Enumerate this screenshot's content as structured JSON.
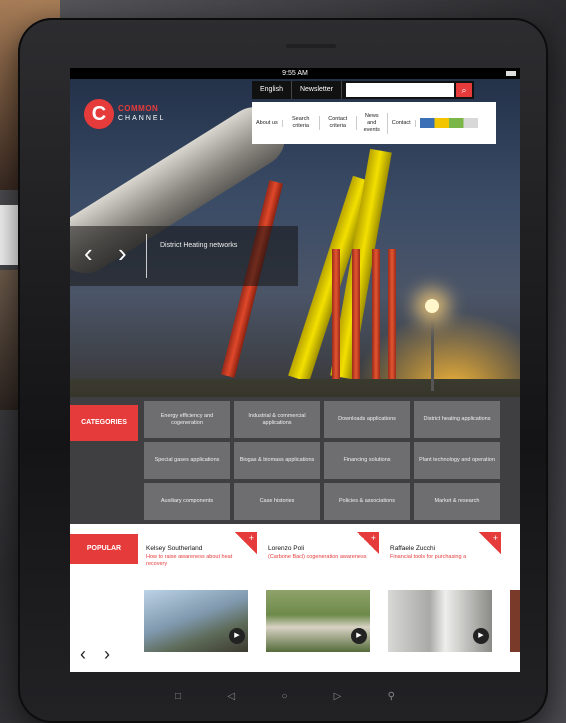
{
  "status_bar": {
    "time": "9:55 AM"
  },
  "site": {
    "logo": {
      "mark": "C",
      "word1": "COMMON",
      "word2": "CHANNEL"
    },
    "top_nav": [
      "English",
      "Newsletter"
    ],
    "search": {
      "placeholder": "",
      "button": "⌕"
    },
    "sub_nav": [
      "About us",
      "Search criteria",
      "Contact criteria",
      "News and events",
      "Contact"
    ]
  },
  "hero": {
    "caption": "District Heating networks",
    "prev": "‹",
    "next": "›"
  },
  "categories": {
    "heading": "CATEGORIES",
    "items": [
      "Energy efficiency and cogeneration",
      "Industrial & commercial applications",
      "Downloads applications",
      "District heating applications",
      "Special gases applications",
      "Biogas & biomass applications",
      "Financing solutions",
      "Plant technology and operation",
      "Auxiliary components",
      "Case histories",
      "Policies & associations",
      "Market & research"
    ]
  },
  "popular": {
    "heading": "POPULAR",
    "cards": [
      {
        "name": "Kelsey Southerland",
        "desc": "How to raise awareness about heat recovery"
      },
      {
        "name": "Lorenzo Poli",
        "desc": "(Carbone Bacl) cogeneration awareness"
      },
      {
        "name": "Raffaele Zucchi",
        "desc": "Financial tools for purchasing a"
      }
    ],
    "prev": "‹",
    "next": "›"
  },
  "device_buttons": [
    "□",
    "◁",
    "○",
    "▷",
    "⚲"
  ],
  "colors": {
    "accent": "#e63b3b",
    "tile": "#6e6e70",
    "panel": "#3f3f41"
  }
}
